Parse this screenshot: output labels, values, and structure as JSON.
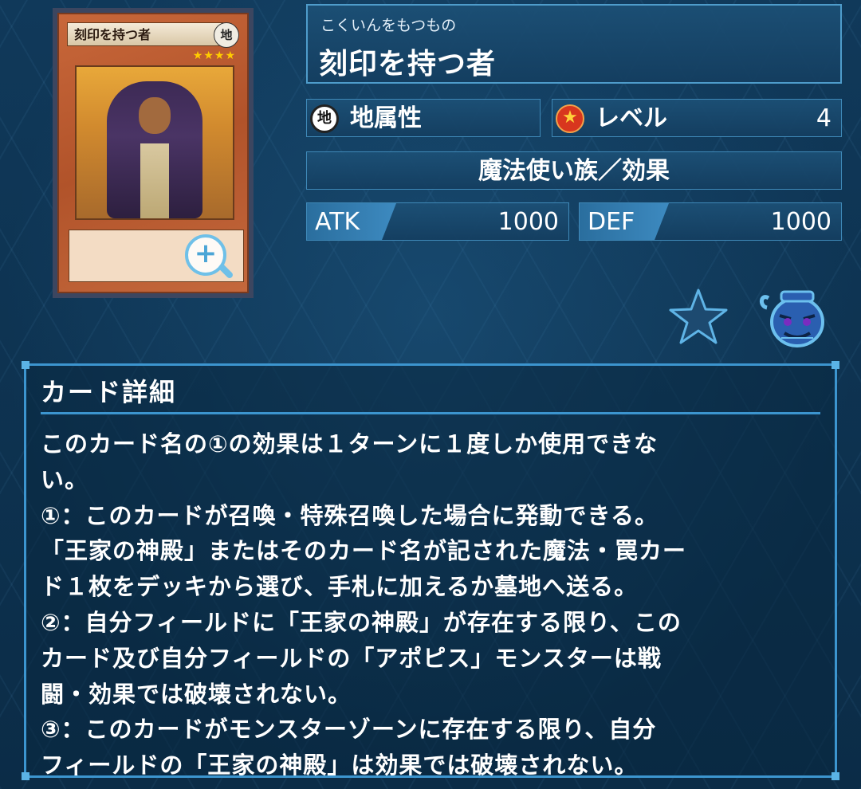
{
  "card": {
    "image_name": "刻印を持つ者",
    "image_attribute": "地",
    "level_stars": "★★★★",
    "zoom_symbol": "+"
  },
  "monster": {
    "name_ruby": "こくいんをもつもの",
    "name": "刻印を持つ者",
    "attribute_icon": "地",
    "attribute": "地属性",
    "level_icon": "★",
    "level_label": "レベル",
    "level_value": "4",
    "type": "魔法使い族／効果",
    "atk_label": "ATK",
    "atk": "1000",
    "def_label": "DEF",
    "def": "1000"
  },
  "actions": {
    "favorite_icon": "star-icon",
    "pot_icon": "pot-of-greed-icon"
  },
  "detail": {
    "title": "カード詳細",
    "text": "このカード名の①の効果は１ターンに１度しか使用できな\nい。\n①：このカードが召喚・特殊召喚した場合に発動できる。\n「王家の神殿」またはそのカード名が記された魔法・罠カー\nド１枚をデッキから選び、手札に加えるか墓地へ送る。\n②：自分フィールドに「王家の神殿」が存在する限り、この\nカード及び自分フィールドの「アポピス」モンスターは戦\n闘・効果では破壊されない。\n③：このカードがモンスターゾーンに存在する限り、自分\nフィールドの「王家の神殿」は効果では破壊されない。"
  },
  "colors": {
    "panel_border": "#3f89b8",
    "accent": "#3c95cf",
    "card_frame": "#b1532a"
  }
}
